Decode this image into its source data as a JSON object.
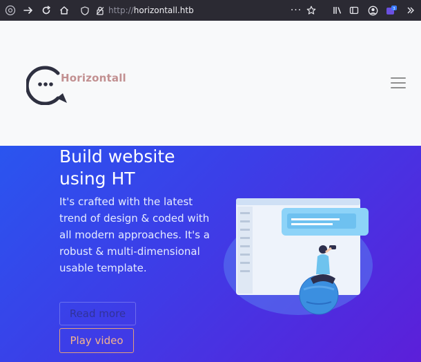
{
  "browser": {
    "url_protocol": "http://",
    "url_host": "horizontall.htb"
  },
  "navbar": {
    "brand": "Horizontall"
  },
  "hero": {
    "title": "Build website using HT",
    "description": "It's crafted with the latest trend of design & coded with all modern approaches. It's a robust & multi-dimensional usable template.",
    "read_more_label": "Read more",
    "play_video_label": "Play video"
  },
  "colors": {
    "toolbar_bg": "#2b2a33",
    "navbar_bg": "#f8f9fa",
    "brand_text": "#c29091",
    "hero_gradient_start": "#2a55ef",
    "hero_gradient_end": "#5c1fd9",
    "play_button_accent": "#e3a07a"
  },
  "icons": {
    "browser_toolbar": [
      "firefox-view-icon",
      "forward-arrow-icon",
      "reload-icon",
      "home-icon",
      "shield-icon",
      "insecure-lock-icon",
      "more-menu-icon",
      "bookmark-star-icon",
      "library-icon",
      "sidebar-icon",
      "account-icon",
      "extension-icon",
      "overflow-icon"
    ],
    "navbar": [
      "chat-bubble-logo-icon",
      "hamburger-menu-icon"
    ]
  }
}
